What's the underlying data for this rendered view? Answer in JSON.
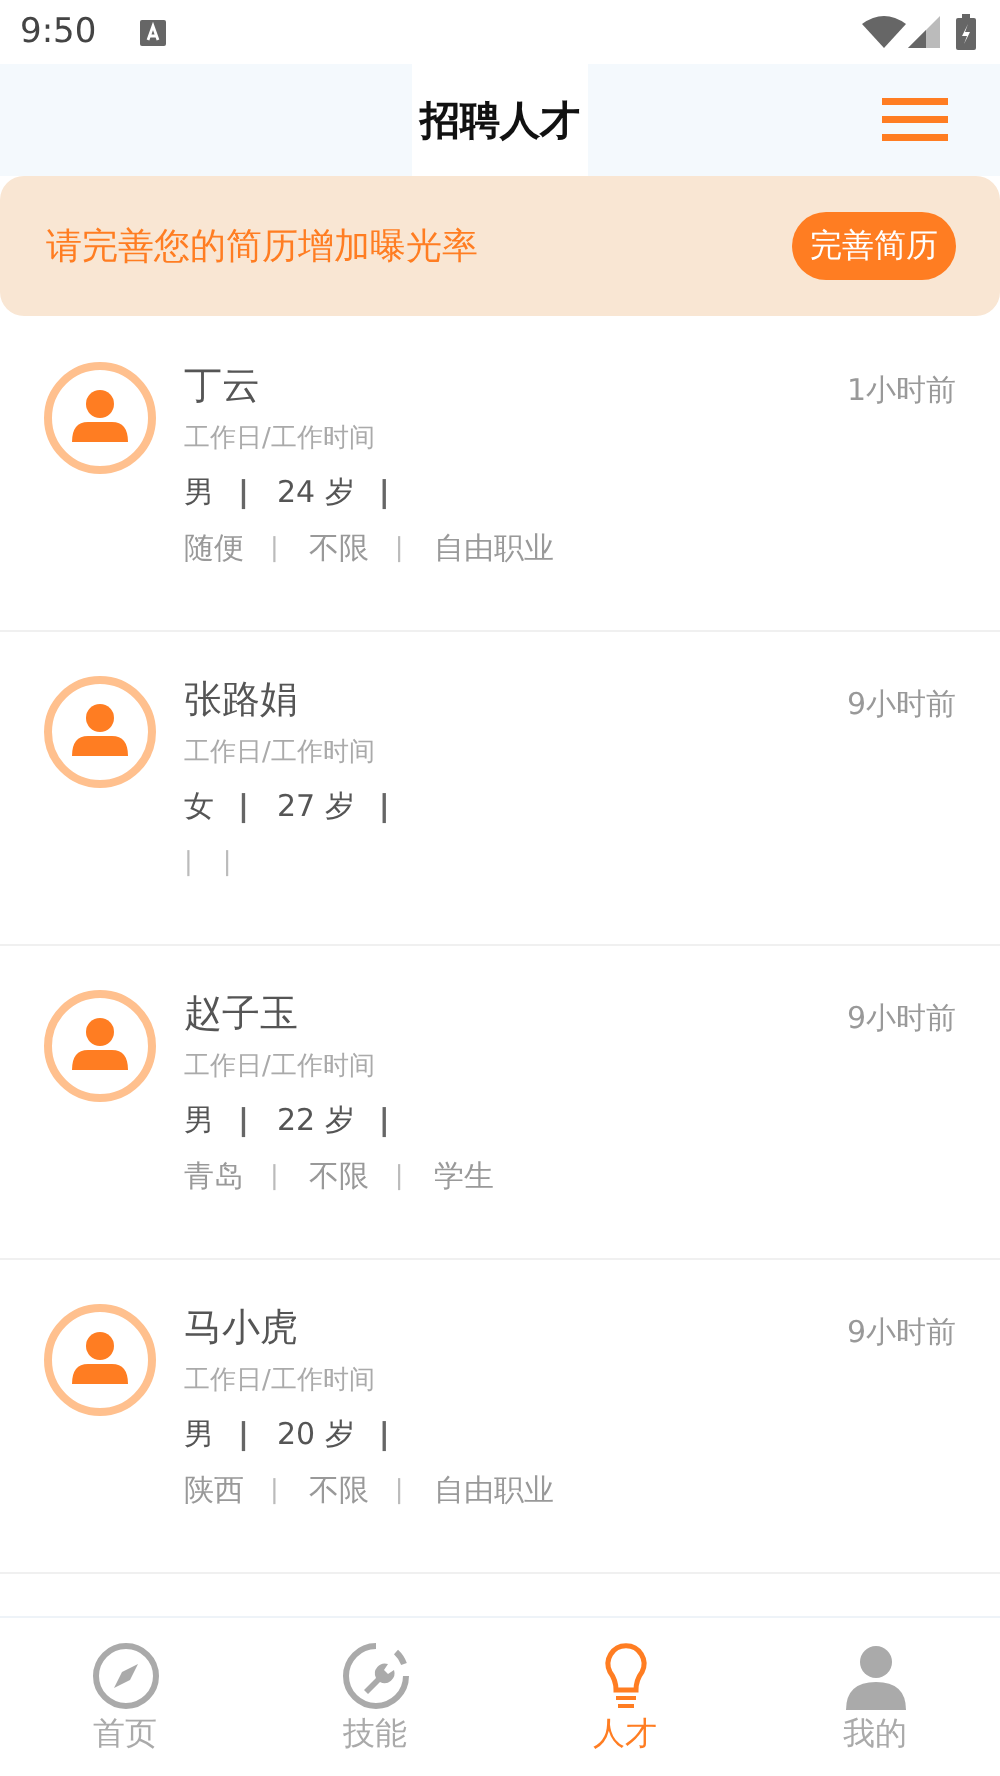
{
  "status_bar": {
    "time": "9:50"
  },
  "header": {
    "title": "招聘人才"
  },
  "banner": {
    "text": "请完善您的简历增加曝光率",
    "button": "完善简历"
  },
  "candidates": [
    {
      "name": "丁云",
      "time": "1小时前",
      "schedule": "工作日/工作时间",
      "info": [
        {
          "kind": "text",
          "text": "男"
        },
        {
          "kind": "separator",
          "text": "|"
        },
        {
          "kind": "text",
          "text": "24 岁"
        },
        {
          "kind": "separator",
          "text": "|"
        }
      ],
      "prefs": [
        {
          "kind": "text",
          "text": "随便"
        },
        {
          "kind": "separator",
          "text": "|"
        },
        {
          "kind": "text",
          "text": "不限"
        },
        {
          "kind": "separator",
          "text": "|"
        },
        {
          "kind": "text",
          "text": "自由职业"
        }
      ]
    },
    {
      "name": "张路娟",
      "time": "9小时前",
      "schedule": "工作日/工作时间",
      "info": [
        {
          "kind": "text",
          "text": "女"
        },
        {
          "kind": "separator",
          "text": "|"
        },
        {
          "kind": "text",
          "text": "27 岁"
        },
        {
          "kind": "separator",
          "text": "|"
        }
      ],
      "prefs": [
        {
          "kind": "separator",
          "text": "|"
        },
        {
          "kind": "separator",
          "text": "|"
        }
      ]
    },
    {
      "name": "赵子玉",
      "time": "9小时前",
      "schedule": "工作日/工作时间",
      "info": [
        {
          "kind": "text",
          "text": "男"
        },
        {
          "kind": "separator",
          "text": "|"
        },
        {
          "kind": "text",
          "text": "22 岁"
        },
        {
          "kind": "separator",
          "text": "|"
        }
      ],
      "prefs": [
        {
          "kind": "text",
          "text": "青岛"
        },
        {
          "kind": "separator",
          "text": "|"
        },
        {
          "kind": "text",
          "text": "不限"
        },
        {
          "kind": "separator",
          "text": "|"
        },
        {
          "kind": "text",
          "text": "学生"
        }
      ]
    },
    {
      "name": "马小虎",
      "time": "9小时前",
      "schedule": "工作日/工作时间",
      "info": [
        {
          "kind": "text",
          "text": "男"
        },
        {
          "kind": "separator",
          "text": "|"
        },
        {
          "kind": "text",
          "text": "20 岁"
        },
        {
          "kind": "separator",
          "text": "|"
        }
      ],
      "prefs": [
        {
          "kind": "text",
          "text": "陕西"
        },
        {
          "kind": "separator",
          "text": "|"
        },
        {
          "kind": "text",
          "text": "不限"
        },
        {
          "kind": "separator",
          "text": "|"
        },
        {
          "kind": "text",
          "text": "自由职业"
        }
      ]
    }
  ],
  "tabs": [
    {
      "label": "首页",
      "selected": false
    },
    {
      "label": "技能",
      "selected": false
    },
    {
      "label": "人才",
      "selected": true
    },
    {
      "label": "我的",
      "selected": false
    }
  ]
}
